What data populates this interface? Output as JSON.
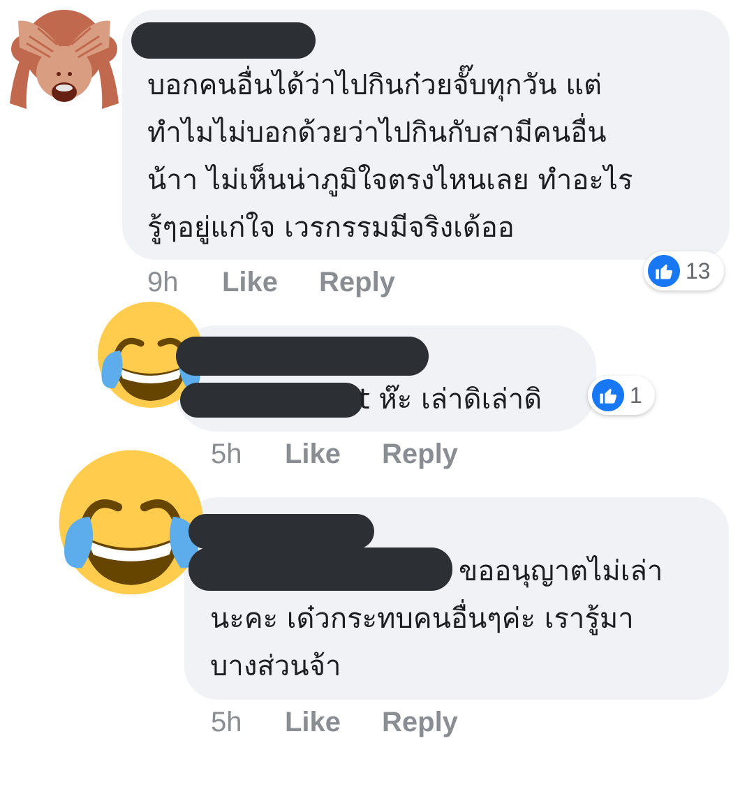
{
  "comments": [
    {
      "text_lines": [
        "บอกคนอื่นได้ว่าไปกินก๋วยจั๊บทุกวัน แต่",
        "ทำไมไม่บอกด้วยว่าไปกินกับสามีคนอื่น",
        "น้าา ไม่เห็นน่าภูมิใจตรงไหนเลย ทำอะไร",
        "รู้ๆอยู่แก่ใจ เวรกรรมมีจริงเด้ออ"
      ],
      "time": "9h",
      "like_label": "Like",
      "reply_label": "Reply",
      "reaction_count": "13"
    },
    {
      "text_lines": [
        "t ห๊ะ เล่าดิเล่าดิ"
      ],
      "time": "5h",
      "like_label": "Like",
      "reply_label": "Reply",
      "reaction_count": "1"
    },
    {
      "text_lines": [
        "ขออนุญาตไม่เล่า",
        "นะคะ เด๋วกระทบคนอื่นๆค่ะ เรารู้มา",
        "บางส่วนจ้า"
      ],
      "time": "5h",
      "like_label": "Like",
      "reply_label": "Reply"
    }
  ],
  "icons": {
    "avatar_1": "see-no-evil-monkey-icon",
    "avatar_2": "tears-of-joy-emoji-icon",
    "avatar_3": "tears-of-joy-emoji-icon",
    "reaction": "thumbs-up-like-icon"
  },
  "colors": {
    "bubble": "#f0f2f5",
    "redaction": "#2c2f33",
    "like_blue": "#1877f2",
    "action_gray": "#8a8d91"
  }
}
